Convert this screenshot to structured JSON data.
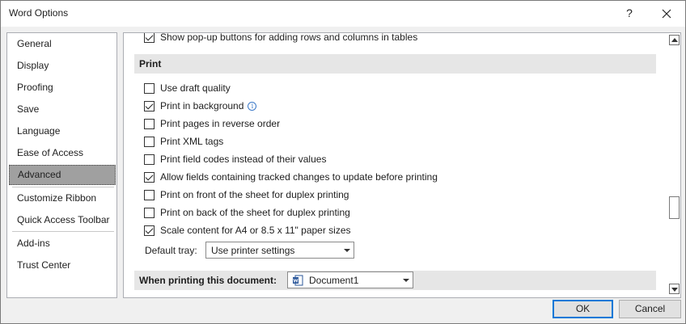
{
  "window": {
    "title": "Word Options",
    "help_glyph": "?"
  },
  "nav": {
    "items": [
      {
        "label": "General"
      },
      {
        "label": "Display"
      },
      {
        "label": "Proofing"
      },
      {
        "label": "Save"
      },
      {
        "label": "Language"
      },
      {
        "label": "Ease of Access"
      },
      {
        "label": "Advanced",
        "selected": true
      },
      {
        "label": "Customize Ribbon"
      },
      {
        "label": "Quick Access Toolbar"
      },
      {
        "label": "Add-ins"
      },
      {
        "label": "Trust Center"
      }
    ]
  },
  "content": {
    "top_option": {
      "label": "Show pop-up buttons for adding rows and columns in tables",
      "checked": true
    },
    "print_section": {
      "header": "Print",
      "options": [
        {
          "label": "Use draft quality",
          "checked": false
        },
        {
          "label": "Print in background",
          "checked": true,
          "info": "i"
        },
        {
          "label": "Print pages in reverse order",
          "checked": false
        },
        {
          "label": "Print XML tags",
          "checked": false
        },
        {
          "label": "Print field codes instead of their values",
          "checked": false
        },
        {
          "label": "Allow fields containing tracked changes to update before printing",
          "checked": true
        },
        {
          "label": "Print on front of the sheet for duplex printing",
          "checked": false
        },
        {
          "label": "Print on back of the sheet for duplex printing",
          "checked": false
        },
        {
          "label": "Scale content for A4 or 8.5 x 11\" paper sizes",
          "checked": true
        }
      ],
      "default_tray": {
        "label": "Default tray:",
        "value": "Use printer settings"
      }
    },
    "when_printing": {
      "label": "When printing this document:",
      "document": "Document1"
    }
  },
  "buttons": {
    "ok": "OK",
    "cancel": "Cancel"
  },
  "colors": {
    "selected_nav": "#a0a0a0",
    "ok_border": "#0078d7",
    "section_bg": "#e6e6e6",
    "word_blue": "#2b579a"
  }
}
